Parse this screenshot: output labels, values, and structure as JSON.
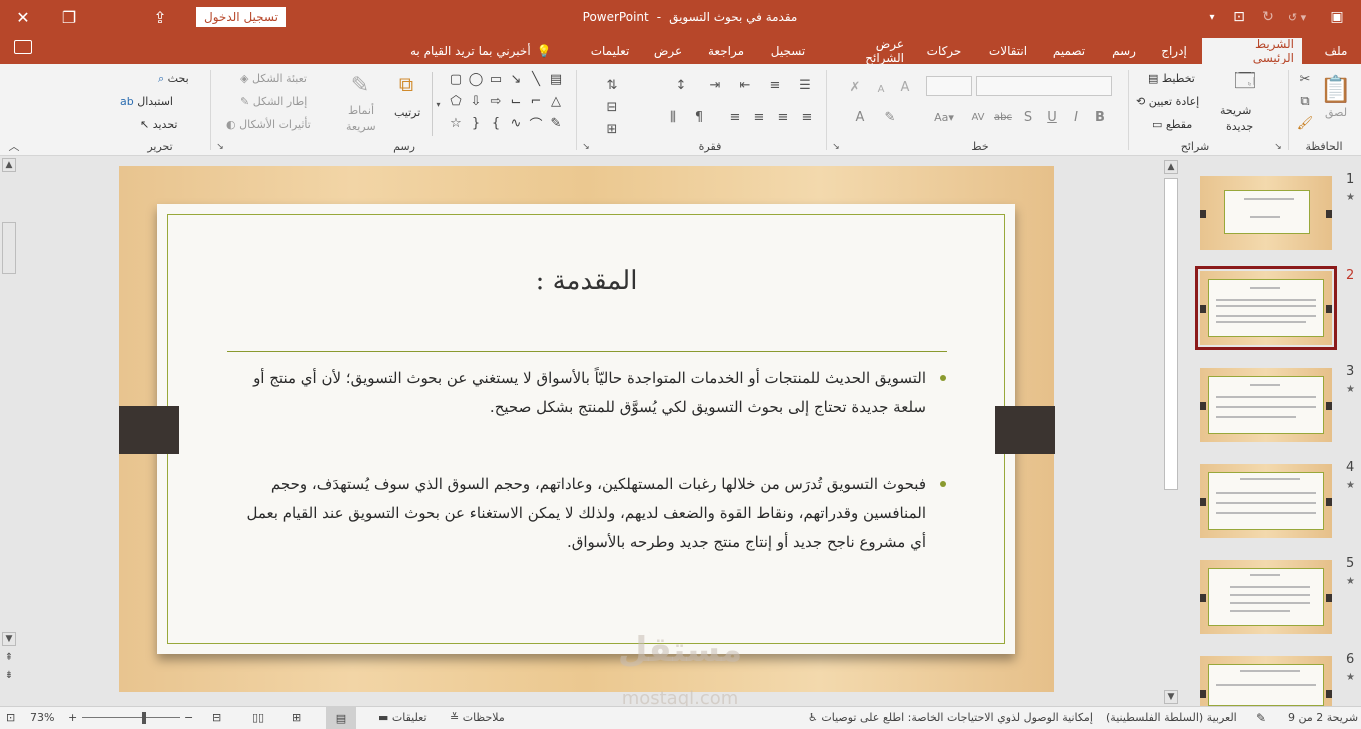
{
  "titlebar": {
    "document_name": "مقدمة في بحوث التسويق",
    "app_name": "PowerPoint",
    "separator": "-",
    "signin_label": "تسجيل الدخول"
  },
  "tabs": {
    "items": [
      {
        "label": "ملف"
      },
      {
        "label": "الشريط الرئيسي"
      },
      {
        "label": "إدراج"
      },
      {
        "label": "رسم"
      },
      {
        "label": "تصميم"
      },
      {
        "label": "انتقالات"
      },
      {
        "label": "حركات"
      },
      {
        "label": "عرض الشرائح"
      },
      {
        "label": "تسجيل"
      },
      {
        "label": "مراجعة"
      },
      {
        "label": "عرض"
      },
      {
        "label": "تعليمات"
      }
    ],
    "tell_me": "أخبرني بما تريد القيام به"
  },
  "ribbon": {
    "clipboard": {
      "label": "الحافظة",
      "paste": "لصق"
    },
    "slides": {
      "label": "شرائح",
      "new_slide_line1": "شريحة",
      "new_slide_line2": "جديدة",
      "layout": "تخطيط",
      "reset": "إعادة تعيين",
      "section": "مقطع"
    },
    "font": {
      "label": "خط"
    },
    "paragraph": {
      "label": "فقرة"
    },
    "drawing": {
      "label": "رسم",
      "arrange": "ترتيب",
      "quick_styles_line1": "أنماط",
      "quick_styles_line2": "سريعة",
      "shape_fill": "تعبئة الشكل",
      "shape_outline": "إطار الشكل",
      "shape_effects": "تأثيرات الأشكال"
    },
    "editing": {
      "label": "تحرير",
      "find": "بحث",
      "replace": "استبدال",
      "select": "تحديد"
    }
  },
  "slide": {
    "title": "المقدمة :",
    "bullets": [
      {
        "text": "التسويق الحديث للمنتجات أو الخدمات المتواجدة حاليّاً بالأسواق لا يستغني عن بحوث التسويق؛ لأن أي منتج أو سلعة جديدة تحتاج إلى بحوث التسويق لكي يُسوَّق للمنتج بشكل صحيح."
      },
      {
        "text": "فبحوث التسويق تُدرَس من خلالها رغبات المستهلكين، وعاداتهم، وحجم السوق الذي سوف يُستهدَف، وحجم المنافسين وقدراتهم، ونقاط القوة والضعف لديهم، ولذلك لا يمكن الاستغناء عن بحوث التسويق عند القيام بعمل أي مشروع ناجح جديد أو إنتاج منتج جديد وطرحه بالأسواق."
      }
    ]
  },
  "watermark": {
    "arabic": "مستقل",
    "latin": "mostaql.com"
  },
  "thumbnails": [
    {
      "number": "1",
      "star": "★"
    },
    {
      "number": "2",
      "star": ""
    },
    {
      "number": "3",
      "star": "★"
    },
    {
      "number": "4",
      "star": "★"
    },
    {
      "number": "5",
      "star": "★"
    },
    {
      "number": "6",
      "star": "★"
    }
  ],
  "statusbar": {
    "slide_counter": "شريحة 2 من 9",
    "language": "العربية (السلطة الفلسطينية)",
    "accessibility": "إمكانية الوصول لذوي الاحتياجات الخاصة: اطلع على توصيات",
    "notes": "ملاحظات",
    "comments": "تعليقات",
    "zoom": "73%",
    "zoom_minus": "−",
    "zoom_plus": "+"
  }
}
